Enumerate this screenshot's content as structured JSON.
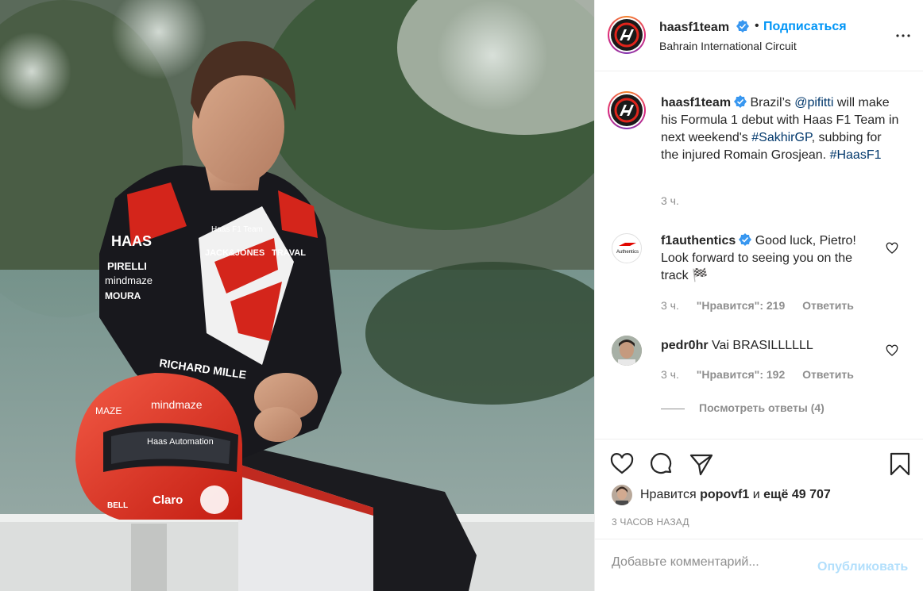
{
  "header": {
    "username": "haasf1team",
    "separator": "•",
    "follow_label": "Подписаться",
    "location": "Bahrain International Circuit"
  },
  "caption": {
    "username": "haasf1team",
    "text_1": "Brazil’s",
    "mention": "@pifitti",
    "text_2": "will make his Formula 1 debut with Haas F1 Team in next weekend's",
    "hashtag_1": "#SakhirGP",
    "text_3": ", subbing for the injured Romain Grosjean.",
    "hashtag_2": "#HaasF1",
    "time": "3 ч."
  },
  "comments": [
    {
      "username": "f1authentics",
      "text": "Good luck, Pietro! Look forward to seeing you on the track 🏁",
      "time": "3 ч.",
      "likes": "\"Нравится\": 219",
      "reply_label": "Ответить",
      "avatar_text": "Authentics"
    },
    {
      "username": "pedr0hr",
      "text": "Vai BRASILLLLLL",
      "time": "3 ч.",
      "likes": "\"Нравится\": 192",
      "reply_label": "Ответить"
    }
  ],
  "view_replies": "Посмотреть ответы (4)",
  "likes": {
    "prefix": "Нравится",
    "user": "popovf1",
    "middle": "и",
    "rest": "ещё 49 707"
  },
  "post_time": "3 ЧАСОВ НАЗАД",
  "add_comment": {
    "placeholder": "Добавьте комментарий...",
    "publish_label": "Опубликовать"
  },
  "photo": {
    "suit_texts": [
      "HAAS",
      "PIRELLI",
      "mindmaze",
      "MOURA",
      "JACK&JONES",
      "TRAVAL",
      "RICHARD MILLE",
      "Haas F1 Team"
    ],
    "helmet_texts": [
      "mindmaze",
      "Haas Automation",
      "Claro",
      "BELL",
      "MAZE"
    ]
  },
  "colors": {
    "accent": "#0095f6",
    "link": "#00376b",
    "muted": "#8e8e8e",
    "haas_red": "#e1241b",
    "publish_disabled": "#b2dffc"
  }
}
